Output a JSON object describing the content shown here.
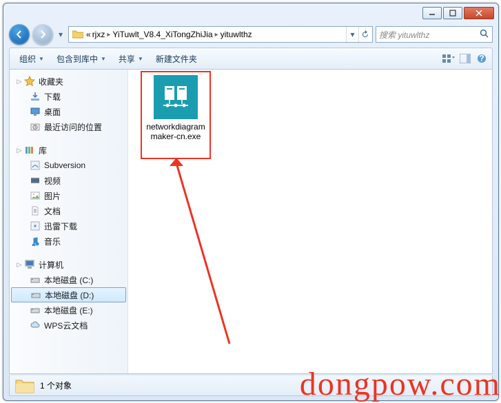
{
  "titlebar": {
    "minimize": "–",
    "maximize": "☐",
    "close": "✕"
  },
  "nav": {
    "back_icon": "←",
    "forward_icon": "→"
  },
  "address": {
    "prefix": "«",
    "segments": [
      "rjxz",
      "YiTuwlt_V8.4_XiTongZhiJia",
      "yituwlthz"
    ]
  },
  "search": {
    "placeholder": "搜索 yituwlthz"
  },
  "toolbar": {
    "organize": "组织",
    "include": "包含到库中",
    "share": "共享",
    "new_folder": "新建文件夹"
  },
  "sidebar": {
    "favorites": "收藏夹",
    "downloads": "下载",
    "desktop": "桌面",
    "recent": "最近访问的位置",
    "libraries": "库",
    "subversion": "Subversion",
    "videos": "视频",
    "pictures": "图片",
    "documents": "文档",
    "thunder": "迅雷下载",
    "music": "音乐",
    "computer": "计算机",
    "disk_c": "本地磁盘 (C:)",
    "disk_d": "本地磁盘 (D:)",
    "disk_e": "本地磁盘 (E:)",
    "wps": "WPS云文档"
  },
  "files": [
    {
      "name": "networkdiagrammaker-cn.exe"
    }
  ],
  "status": {
    "count_label": "1 个对象"
  },
  "watermark": "dongpow.com"
}
